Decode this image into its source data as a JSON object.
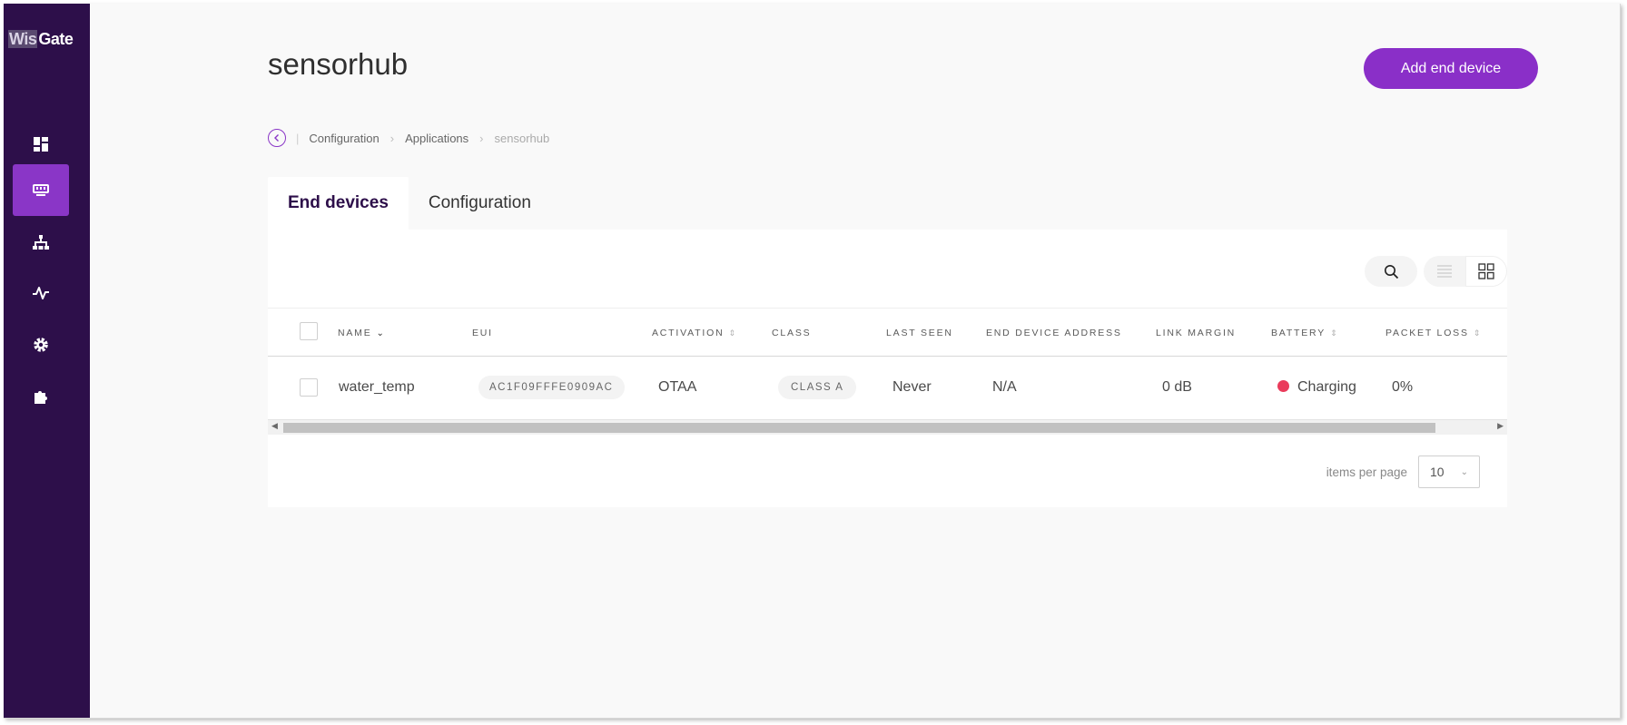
{
  "app": {
    "logo_part1": "Wis",
    "logo_part2": "Gate"
  },
  "sidebar": {
    "items": [
      {
        "icon": "dashboard-icon",
        "active": false
      },
      {
        "icon": "gateway-device-icon",
        "active": true
      },
      {
        "icon": "network-tree-icon",
        "active": false
      },
      {
        "icon": "activity-pulse-icon",
        "active": false
      },
      {
        "icon": "gear-icon",
        "active": false
      },
      {
        "icon": "puzzle-extension-icon",
        "active": false
      }
    ]
  },
  "header": {
    "title": "sensorhub",
    "add_button": "Add end device"
  },
  "breadcrumb": {
    "items": [
      "Configuration",
      "Applications"
    ],
    "current": "sensorhub"
  },
  "tabs": [
    {
      "label": "End devices",
      "active": true
    },
    {
      "label": "Configuration",
      "active": false
    }
  ],
  "table": {
    "columns": {
      "name": "NAME",
      "eui": "EUI",
      "activation": "ACTIVATION",
      "class": "CLASS",
      "last_seen": "LAST SEEN",
      "address": "END DEVICE ADDRESS",
      "link_margin": "LINK MARGIN",
      "battery": "BATTERY",
      "packet_loss": "PACKET LOSS"
    },
    "rows": [
      {
        "name": "water_temp",
        "eui": "AC1F09FFFE0909AC",
        "activation": "OTAA",
        "class": "CLASS A",
        "last_seen": "Never",
        "address": "N/A",
        "link_margin": "0 dB",
        "battery": "Charging",
        "packet_loss": "0%"
      }
    ]
  },
  "pagination": {
    "label": "items per page",
    "value": "10"
  },
  "colors": {
    "sidebar_bg": "#2d0f4a",
    "accent": "#8a2fc8",
    "battery_status": "#ea3b5b"
  }
}
